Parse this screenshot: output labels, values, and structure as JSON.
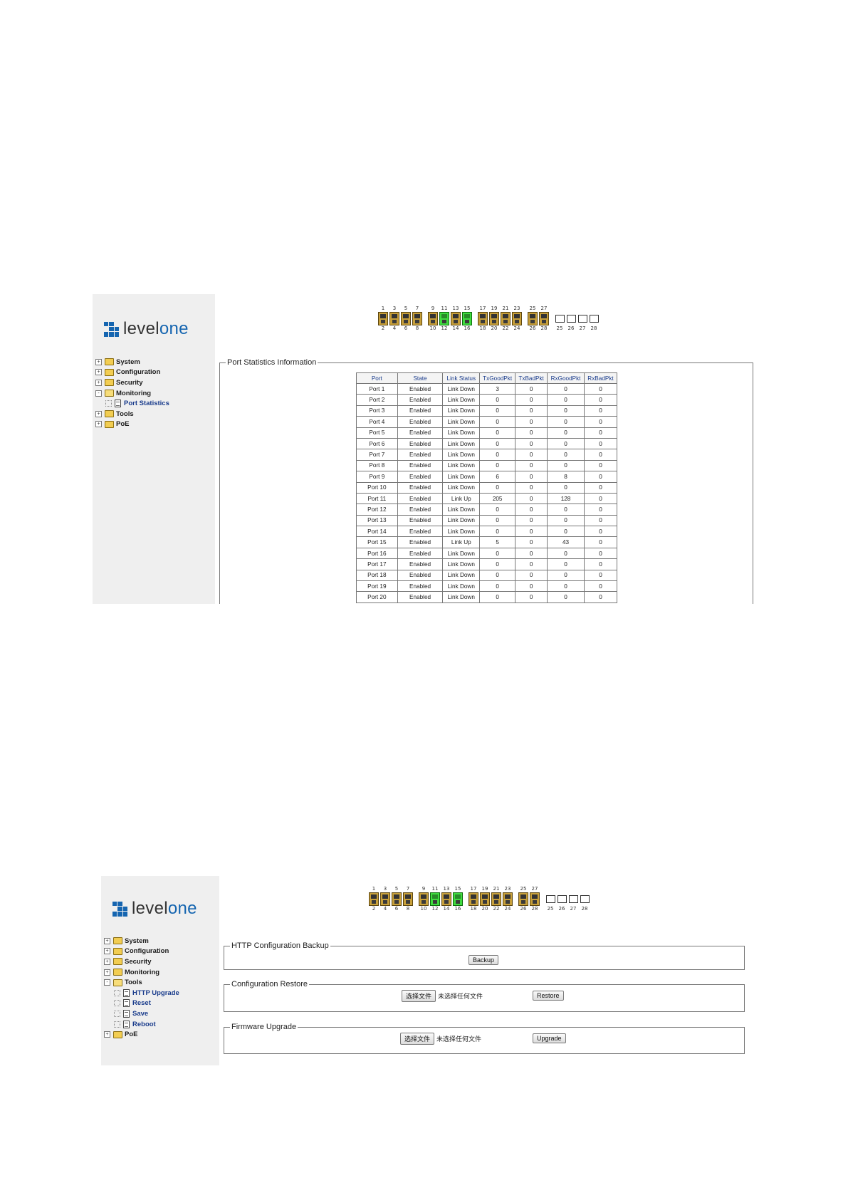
{
  "logo": {
    "text_a": "level",
    "text_b": "one"
  },
  "ports": {
    "groups_top": [
      [
        "1",
        "3",
        "5",
        "7"
      ],
      [
        "9",
        "11",
        "13",
        "15"
      ],
      [
        "17",
        "19",
        "21",
        "23"
      ],
      [
        "25",
        "27"
      ]
    ],
    "groups_bottom": [
      [
        "2",
        "4",
        "6",
        "8"
      ],
      [
        "10",
        "12",
        "14",
        "16"
      ],
      [
        "18",
        "20",
        "22",
        "24"
      ],
      [
        "26",
        "28"
      ]
    ],
    "link_up_top": [
      "11",
      "15"
    ],
    "sfp_labels": [
      "25",
      "26",
      "27",
      "28"
    ]
  },
  "screen1": {
    "tree": [
      {
        "label": "System",
        "expander": "+",
        "type": "folder"
      },
      {
        "label": "Configuration",
        "expander": "+",
        "type": "folder"
      },
      {
        "label": "Security",
        "expander": "+",
        "type": "folder"
      },
      {
        "label": "Monitoring",
        "expander": "-",
        "type": "folder-open"
      },
      {
        "label": "Port Statistics",
        "type": "leaf"
      },
      {
        "label": "Tools",
        "expander": "+",
        "type": "folder"
      },
      {
        "label": "PoE",
        "expander": "+",
        "type": "folder"
      }
    ],
    "legend": "Port Statistics Information",
    "table": {
      "headers": [
        "Port",
        "State",
        "Link Status",
        "TxGoodPkt",
        "TxBadPkt",
        "RxGoodPkt",
        "RxBadPkt"
      ],
      "rows": [
        [
          "Port 1",
          "Enabled",
          "Link Down",
          "3",
          "0",
          "0",
          "0"
        ],
        [
          "Port 2",
          "Enabled",
          "Link Down",
          "0",
          "0",
          "0",
          "0"
        ],
        [
          "Port 3",
          "Enabled",
          "Link Down",
          "0",
          "0",
          "0",
          "0"
        ],
        [
          "Port 4",
          "Enabled",
          "Link Down",
          "0",
          "0",
          "0",
          "0"
        ],
        [
          "Port 5",
          "Enabled",
          "Link Down",
          "0",
          "0",
          "0",
          "0"
        ],
        [
          "Port 6",
          "Enabled",
          "Link Down",
          "0",
          "0",
          "0",
          "0"
        ],
        [
          "Port 7",
          "Enabled",
          "Link Down",
          "0",
          "0",
          "0",
          "0"
        ],
        [
          "Port 8",
          "Enabled",
          "Link Down",
          "0",
          "0",
          "0",
          "0"
        ],
        [
          "Port 9",
          "Enabled",
          "Link Down",
          "6",
          "0",
          "8",
          "0"
        ],
        [
          "Port 10",
          "Enabled",
          "Link Down",
          "0",
          "0",
          "0",
          "0"
        ],
        [
          "Port 11",
          "Enabled",
          "Link Up",
          "205",
          "0",
          "128",
          "0"
        ],
        [
          "Port 12",
          "Enabled",
          "Link Down",
          "0",
          "0",
          "0",
          "0"
        ],
        [
          "Port 13",
          "Enabled",
          "Link Down",
          "0",
          "0",
          "0",
          "0"
        ],
        [
          "Port 14",
          "Enabled",
          "Link Down",
          "0",
          "0",
          "0",
          "0"
        ],
        [
          "Port 15",
          "Enabled",
          "Link Up",
          "5",
          "0",
          "43",
          "0"
        ],
        [
          "Port 16",
          "Enabled",
          "Link Down",
          "0",
          "0",
          "0",
          "0"
        ],
        [
          "Port 17",
          "Enabled",
          "Link Down",
          "0",
          "0",
          "0",
          "0"
        ],
        [
          "Port 18",
          "Enabled",
          "Link Down",
          "0",
          "0",
          "0",
          "0"
        ],
        [
          "Port 19",
          "Enabled",
          "Link Down",
          "0",
          "0",
          "0",
          "0"
        ],
        [
          "Port 20",
          "Enabled",
          "Link Down",
          "0",
          "0",
          "0",
          "0"
        ]
      ]
    }
  },
  "screen2": {
    "tree": [
      {
        "label": "System",
        "expander": "+",
        "type": "folder"
      },
      {
        "label": "Configuration",
        "expander": "+",
        "type": "folder"
      },
      {
        "label": "Security",
        "expander": "+",
        "type": "folder"
      },
      {
        "label": "Monitoring",
        "expander": "+",
        "type": "folder"
      },
      {
        "label": "Tools",
        "expander": "-",
        "type": "folder-open"
      },
      {
        "label": "HTTP Upgrade",
        "type": "leaf"
      },
      {
        "label": "Reset",
        "type": "leaf"
      },
      {
        "label": "Save",
        "type": "leaf"
      },
      {
        "label": "Reboot",
        "type": "leaf"
      },
      {
        "label": "PoE",
        "expander": "+",
        "type": "folder"
      }
    ],
    "backup": {
      "legend": "HTTP Configuration Backup",
      "button": "Backup"
    },
    "restore": {
      "legend": "Configuration Restore",
      "choose_button": "选择文件",
      "no_file": "未选择任何文件",
      "button": "Restore"
    },
    "upgrade": {
      "legend": "Firmware Upgrade",
      "choose_button": "选择文件",
      "no_file": "未选择任何文件",
      "button": "Upgrade"
    }
  }
}
